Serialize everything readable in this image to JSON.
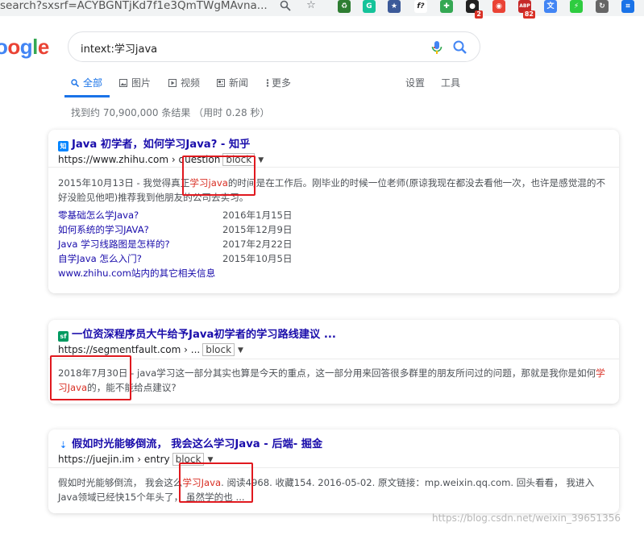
{
  "browser": {
    "url_fragment": "search?sxsrf=ACYBGNTjKd7f1e3QmTWgMAvna...",
    "zoom_icon": "magnifier-icon",
    "star_icon": "bookmark-star-icon",
    "extensions": [
      {
        "name": "recycle-ext-icon",
        "color": "#2e7d32",
        "glyph": "♻",
        "badge": ""
      },
      {
        "name": "grammarly-ext-icon",
        "color": "#15c39a",
        "glyph": "G",
        "badge": ""
      },
      {
        "name": "star-box-ext-icon",
        "color": "#3c5a99",
        "glyph": "★",
        "badge": ""
      },
      {
        "name": "formula-ext-icon",
        "color": "#ffffff",
        "glyph": "f?",
        "badge": ""
      },
      {
        "name": "puzzle-ext-icon",
        "color": "#34a853",
        "glyph": "✚",
        "badge": ""
      },
      {
        "name": "black-ext-icon",
        "color": "#222222",
        "glyph": "●",
        "badge": "2"
      },
      {
        "name": "color-ext-icon",
        "color": "#ea4335",
        "glyph": "◉",
        "badge": ""
      },
      {
        "name": "adblock-ext-icon",
        "color": "#c62828",
        "glyph": "ABP",
        "badge": "82"
      },
      {
        "name": "translate-ext-icon",
        "color": "#4285f4",
        "glyph": "文",
        "badge": ""
      },
      {
        "name": "lightning-ext-icon",
        "color": "#2ecc40",
        "glyph": "⚡",
        "badge": ""
      },
      {
        "name": "refresh-ext-icon",
        "color": "#666666",
        "glyph": "↻",
        "badge": ""
      },
      {
        "name": "crop-ext-icon",
        "color": "#1a73e8",
        "glyph": "⌗",
        "badge": ""
      }
    ]
  },
  "search": {
    "logo_letters": [
      "o",
      "o",
      "g",
      "l",
      "e"
    ],
    "query": "intext:学习java",
    "tabs": [
      "全部",
      "图片",
      "视频",
      "新闻",
      "更多"
    ],
    "tools": [
      "设置",
      "工具"
    ],
    "stats": "找到约 70,900,000 条结果  （用时 0.28 秒）"
  },
  "results": [
    {
      "favicon_text": "知",
      "favicon_color": "#0084ff",
      "title": "Java 初学者，如何学习Java? - 知乎",
      "url_host": "https://www.zhihu.com",
      "url_path": " › question",
      "block_label": "block",
      "snippet_pre": "2015年10月13日 - 我觉得真正",
      "snippet_em": "学习java",
      "snippet_post": "的时间是在工作后。刚毕业的时候一位老师(原谅我现在都没去看他一次，也许是感觉混的不好没脸见他吧)推荐我到他朋友的公司去实习。",
      "sublinks": [
        {
          "label": "零基础怎么学Java?",
          "date": "2016年1月15日"
        },
        {
          "label": "如何系统的学习JAVA?",
          "date": "2015年12月9日"
        },
        {
          "label": "Java 学习线路图是怎样的?",
          "date": "2017年2月22日"
        },
        {
          "label": "自学Java 怎么入门?",
          "date": "2015年10月5日"
        }
      ],
      "more_label": "www.zhihu.com站内的其它相关信息"
    },
    {
      "favicon_text": "sf",
      "favicon_color": "#009a61",
      "title": "一位资深程序员大牛给予Java初学者的学习路线建议 ...",
      "url_host": "https://segmentfault.com",
      "url_path": " › ...",
      "block_label": "block",
      "snippet_pre": "2018年7月30日 - java学习这一部分其实也算是今天的重点，这一部分用来回答很多群里的朋友所问过的问题，那就是我你是如何",
      "snippet_em": "学习Java",
      "snippet_post": "的，能不能给点建议?"
    },
    {
      "favicon_text": "⇣",
      "favicon_color": "#1e80ff",
      "title": "假如时光能够倒流， 我会这么学习Java - 后端- 掘金",
      "url_host": "https://juejin.im",
      "url_path": " › entry",
      "block_label": "block",
      "snippet_pre": "假如时光能够倒流， 我会这么",
      "snippet_em": "学习Java",
      "snippet_post": ". 阅读4968. 收藏154. 2016-05-02. 原文链接：mp.weixin.qq.com. 回头看看， 我进入Java领域已经快15个年头了， 虽然学的也 ..."
    }
  ],
  "watermark": "https://blog.csdn.net/weixin_39651356"
}
